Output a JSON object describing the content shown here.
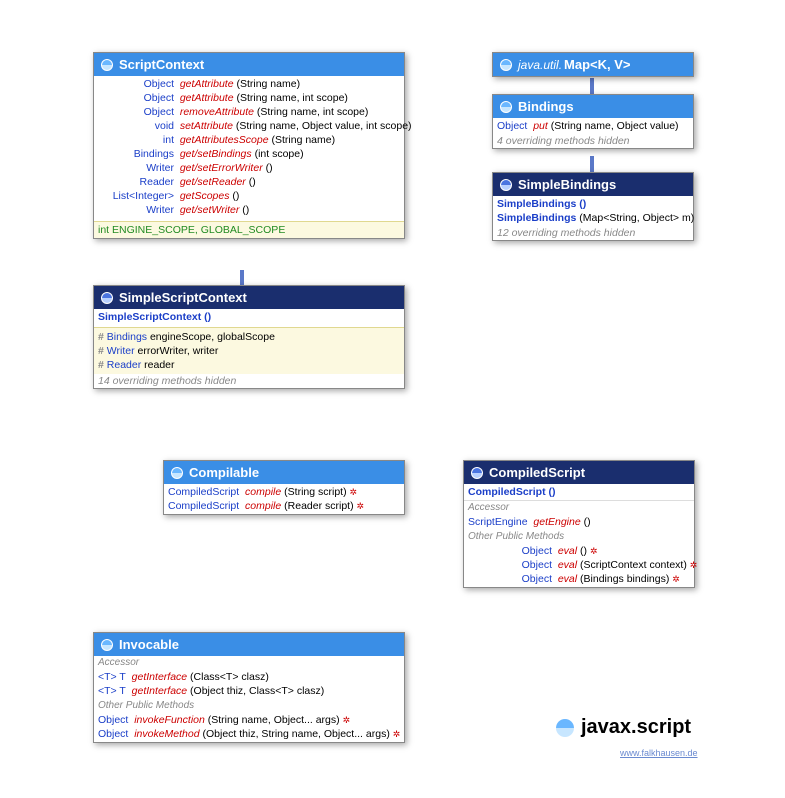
{
  "package": {
    "prefix": "",
    "name": "javax.script",
    "credit": "www.falkhausen.de"
  },
  "scriptContext": {
    "title": "ScriptContext",
    "methods": [
      {
        "ret": "Object",
        "name": "getAttribute",
        "params": "(String name)"
      },
      {
        "ret": "Object",
        "name": "getAttribute",
        "params": "(String name, int scope)"
      },
      {
        "ret": "Object",
        "name": "removeAttribute",
        "params": "(String name, int scope)"
      },
      {
        "ret": "void",
        "name": "setAttribute",
        "params": "(String name, Object value, int scope)"
      },
      {
        "ret": "int",
        "name": "getAttributesScope",
        "params": "(String name)"
      },
      {
        "ret": "Bindings",
        "name": "get/setBindings",
        "params": "(int scope)"
      },
      {
        "ret": "Writer",
        "name": "get/setErrorWriter",
        "params": "()"
      },
      {
        "ret": "Reader",
        "name": "get/setReader",
        "params": "()"
      },
      {
        "ret": "List<Integer>",
        "name": "getScopes",
        "params": "()"
      },
      {
        "ret": "Writer",
        "name": "get/setWriter",
        "params": "()"
      }
    ],
    "constants": "int ENGINE_SCOPE, GLOBAL_SCOPE"
  },
  "simpleScriptContext": {
    "title": "SimpleScriptContext",
    "ctor": "SimpleScriptContext ()",
    "fields": [
      {
        "type": "Bindings",
        "names": "engineScope, globalScope"
      },
      {
        "type": "Writer",
        "names": "errorWriter, writer"
      },
      {
        "type": "Reader",
        "names": "reader"
      }
    ],
    "note": "14 overriding methods hidden"
  },
  "map": {
    "prefix": "java.util.",
    "title": "Map<K, V>"
  },
  "bindings": {
    "title": "Bindings",
    "methods": [
      {
        "ret": "Object",
        "name": "put",
        "params": "(String name, Object value)"
      }
    ],
    "note": "4 overriding methods hidden"
  },
  "simpleBindings": {
    "title": "SimpleBindings",
    "ctors": [
      "SimpleBindings ()",
      "SimpleBindings (Map<String, Object> m)"
    ],
    "note": "12 overriding methods hidden"
  },
  "compilable": {
    "title": "Compilable",
    "methods": [
      {
        "ret": "CompiledScript",
        "name": "compile",
        "params": "(String script)",
        "exc": true
      },
      {
        "ret": "CompiledScript",
        "name": "compile",
        "params": "(Reader script)",
        "exc": true
      }
    ]
  },
  "compiledScript": {
    "title": "CompiledScript",
    "ctor": "CompiledScript ()",
    "accessorLabel": "Accessor",
    "accessors": [
      {
        "ret": "ScriptEngine",
        "name": "getEngine",
        "params": "()"
      }
    ],
    "otherLabel": "Other Public Methods",
    "others": [
      {
        "ret": "Object",
        "name": "eval",
        "params": "()",
        "exc": true
      },
      {
        "ret": "Object",
        "name": "eval",
        "params": "(ScriptContext context)",
        "exc": true
      },
      {
        "ret": "Object",
        "name": "eval",
        "params": "(Bindings bindings)",
        "exc": true
      }
    ]
  },
  "invocable": {
    "title": "Invocable",
    "accessorLabel": "Accessor",
    "accessors": [
      {
        "ret": "<T> T",
        "name": "getInterface",
        "params": "(Class<T> clasz)"
      },
      {
        "ret": "<T> T",
        "name": "getInterface",
        "params": "(Object thiz, Class<T> clasz)"
      }
    ],
    "otherLabel": "Other Public Methods",
    "others": [
      {
        "ret": "Object",
        "name": "invokeFunction",
        "params": "(String name, Object... args)",
        "exc": true
      },
      {
        "ret": "Object",
        "name": "invokeMethod",
        "params": "(Object thiz, String name, Object... args)",
        "exc": true
      }
    ]
  }
}
